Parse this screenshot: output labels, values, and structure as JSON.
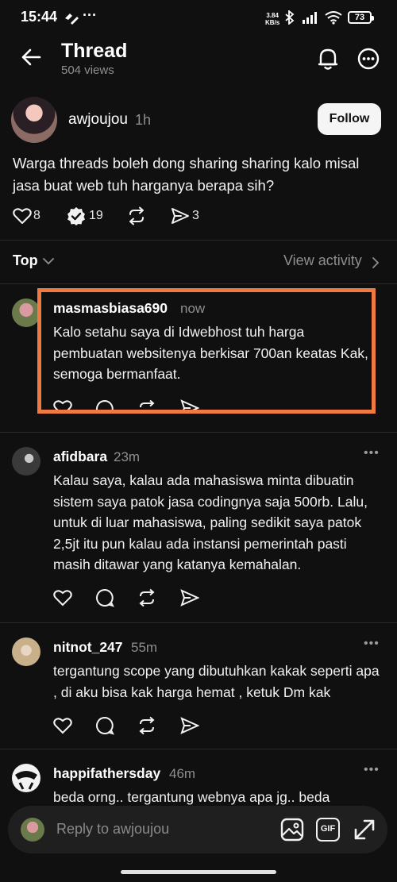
{
  "status_bar": {
    "time": "15:44",
    "speed_value": "3.84",
    "speed_unit": "KB/s",
    "battery": "73"
  },
  "header": {
    "title": "Thread",
    "views": "504 views",
    "icons": [
      "back-arrow-icon",
      "bell-icon",
      "more-circle-icon"
    ]
  },
  "post": {
    "author": "awjoujou",
    "time": "1h",
    "follow_label": "Follow",
    "text": "Warga threads boleh dong sharing sharing kalo misal jasa buat web tuh harganya berapa sih?",
    "likes": "8",
    "replies": "19",
    "reposts": "",
    "shares": "3"
  },
  "sort": {
    "label": "Top",
    "view_activity": "View activity"
  },
  "comments": [
    {
      "username": "masmasbiasa690",
      "time": "now",
      "text": "Kalo setahu saya di Idwebhost tuh harga pembuatan websitenya berkisar 700an keatas Kak, semoga bermanfaat.",
      "highlighted": true
    },
    {
      "username": "afidbara",
      "time": "23m",
      "text": "Kalau saya, kalau ada mahasiswa minta dibuatin sistem saya patok jasa codingnya saja 500rb. Lalu, untuk di luar mahasiswa, paling sedikit saya patok 2,5jt itu pun kalau ada instansi pemerintah pasti masih ditawar yang katanya kemahalan."
    },
    {
      "username": "nitnot_247",
      "time": "55m",
      "text": "tergantung scope yang dibutuhkan kakak seperti apa , di aku bisa kak harga hemat , ketuk Dm kak"
    },
    {
      "username": "happifathersday",
      "time": "46m",
      "text": "beda orng.. tergantung webnya apa jg.. beda"
    }
  ],
  "reply_bar": {
    "placeholder": "Reply to awjoujou",
    "gif_label": "GIF"
  },
  "colors": {
    "background": "#101010",
    "highlight_border": "#f07a42",
    "muted_text": "#8f8f8f"
  }
}
